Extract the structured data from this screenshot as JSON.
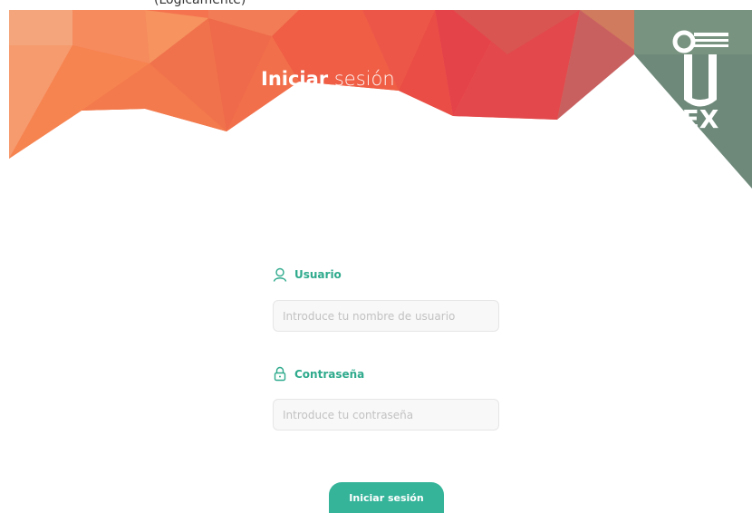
{
  "header": {
    "title_strong": "Iniciar",
    "title_light": "sesión",
    "top_strip_text": "(Lógicamente)",
    "logo_letters": [
      "U",
      "EX"
    ]
  },
  "form": {
    "username": {
      "label": "Usuario",
      "placeholder": "Introduce tu nombre de usuario",
      "value": "",
      "icon": "user-icon"
    },
    "password": {
      "label": "Contraseña",
      "placeholder": "Introduce tu contraseña",
      "value": "",
      "icon": "lock-icon"
    },
    "submit_label": "Iniciar sesión"
  },
  "colors": {
    "accent": "#35b49a",
    "label_accent": "#2eaa8c",
    "banner_orange": "#f58a53",
    "banner_red": "#e9484a",
    "logo_panel": "#6f8a7a"
  }
}
